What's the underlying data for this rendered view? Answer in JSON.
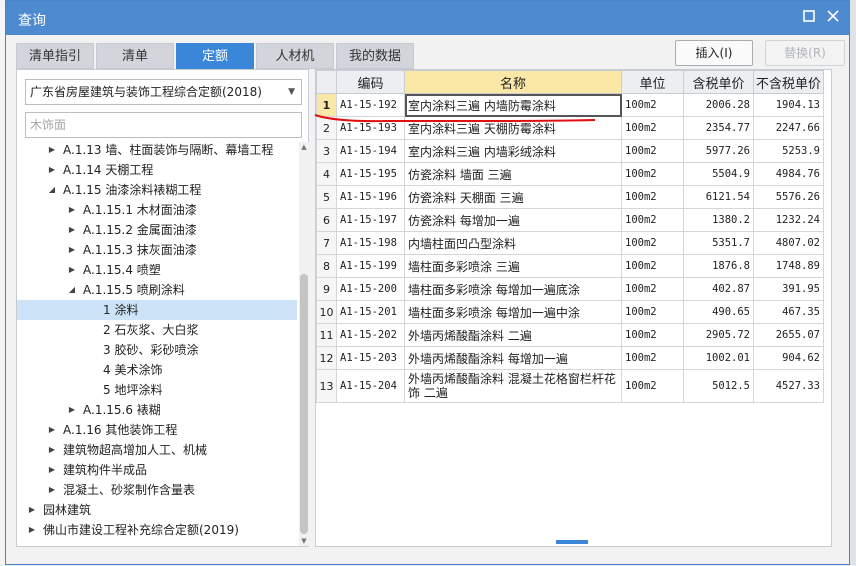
{
  "window": {
    "title": "查询"
  },
  "tabs": [
    {
      "label": "清单指引"
    },
    {
      "label": "清单"
    },
    {
      "label": "定额"
    },
    {
      "label": "人材机"
    },
    {
      "label": "我的数据"
    }
  ],
  "actions": {
    "insert": "插入(I)",
    "replace": "替换(R)"
  },
  "left": {
    "standard": "广东省房屋建筑与装饰工程综合定额(2018)",
    "search_placeholder": "木饰面",
    "tree": [
      {
        "label": "A.1.13 墙、柱面装饰与隔断、幕墙工程",
        "level": 2,
        "caret": "right"
      },
      {
        "label": "A.1.14 天棚工程",
        "level": 2,
        "caret": "right"
      },
      {
        "label": "A.1.15 油漆涂料裱糊工程",
        "level": 2,
        "caret": "down"
      },
      {
        "label": "A.1.15.1 木材面油漆",
        "level": 3,
        "caret": "right"
      },
      {
        "label": "A.1.15.2 金属面油漆",
        "level": 3,
        "caret": "right"
      },
      {
        "label": "A.1.15.3 抹灰面油漆",
        "level": 3,
        "caret": "right"
      },
      {
        "label": "A.1.15.4 喷塑",
        "level": 3,
        "caret": "right"
      },
      {
        "label": "A.1.15.5 喷刷涂料",
        "level": 3,
        "caret": "down"
      },
      {
        "label": "1 涂料",
        "level": 4,
        "caret": "",
        "selected": true
      },
      {
        "label": "2 石灰浆、大白浆",
        "level": 4,
        "caret": ""
      },
      {
        "label": "3 胶砂、彩砂喷涂",
        "level": 4,
        "caret": ""
      },
      {
        "label": "4 美术涂饰",
        "level": 4,
        "caret": ""
      },
      {
        "label": "5 地坪涂料",
        "level": 4,
        "caret": ""
      },
      {
        "label": "A.1.15.6 裱糊",
        "level": 3,
        "caret": "right"
      },
      {
        "label": "A.1.16 其他装饰工程",
        "level": 2,
        "caret": "right"
      },
      {
        "label": "建筑物超高增加人工、机械",
        "level": 2,
        "caret": "right"
      },
      {
        "label": "建筑构件半成品",
        "level": 2,
        "caret": "right"
      },
      {
        "label": "混凝土、砂浆制作含量表",
        "level": 2,
        "caret": "right"
      },
      {
        "label": "园林建筑",
        "level": 1,
        "caret": "right"
      },
      {
        "label": "佛山市建设工程补充综合定额(2019)",
        "level": 1,
        "caret": "right"
      }
    ]
  },
  "grid": {
    "columns": [
      "",
      "编码",
      "名称",
      "单位",
      "含税单价",
      "不含税单价"
    ],
    "rows": [
      {
        "no": "1",
        "code": "A1-15-192",
        "name": "室内涂料三遍 内墙防霉涂料",
        "unit": "100m2",
        "price_tax": "2006.28",
        "price_notax": "1904.13",
        "selected": true
      },
      {
        "no": "2",
        "code": "A1-15-193",
        "name": "室内涂料三遍 天棚防霉涂料",
        "unit": "100m2",
        "price_tax": "2354.77",
        "price_notax": "2247.66"
      },
      {
        "no": "3",
        "code": "A1-15-194",
        "name": "室内涂料三遍 内墙彩绒涂料",
        "unit": "100m2",
        "price_tax": "5977.26",
        "price_notax": "5253.9"
      },
      {
        "no": "4",
        "code": "A1-15-195",
        "name": "仿瓷涂料 墙面 三遍",
        "unit": "100m2",
        "price_tax": "5504.9",
        "price_notax": "4984.76"
      },
      {
        "no": "5",
        "code": "A1-15-196",
        "name": "仿瓷涂料 天棚面 三遍",
        "unit": "100m2",
        "price_tax": "6121.54",
        "price_notax": "5576.26"
      },
      {
        "no": "6",
        "code": "A1-15-197",
        "name": "仿瓷涂料 每增加一遍",
        "unit": "100m2",
        "price_tax": "1380.2",
        "price_notax": "1232.24"
      },
      {
        "no": "7",
        "code": "A1-15-198",
        "name": "内墙柱面凹凸型涂料",
        "unit": "100m2",
        "price_tax": "5351.7",
        "price_notax": "4807.02"
      },
      {
        "no": "8",
        "code": "A1-15-199",
        "name": "墙柱面多彩喷涂 三遍",
        "unit": "100m2",
        "price_tax": "1876.8",
        "price_notax": "1748.89"
      },
      {
        "no": "9",
        "code": "A1-15-200",
        "name": "墙柱面多彩喷涂 每增加一遍底涂",
        "unit": "100m2",
        "price_tax": "402.87",
        "price_notax": "391.95"
      },
      {
        "no": "10",
        "code": "A1-15-201",
        "name": "墙柱面多彩喷涂 每增加一遍中涂",
        "unit": "100m2",
        "price_tax": "490.65",
        "price_notax": "467.35"
      },
      {
        "no": "11",
        "code": "A1-15-202",
        "name": "外墙丙烯酸酯涂料 二遍",
        "unit": "100m2",
        "price_tax": "2905.72",
        "price_notax": "2655.07"
      },
      {
        "no": "12",
        "code": "A1-15-203",
        "name": "外墙丙烯酸酯涂料 每增加一遍",
        "unit": "100m2",
        "price_tax": "1002.01",
        "price_notax": "904.62"
      },
      {
        "no": "13",
        "code": "A1-15-204",
        "name": "外墙丙烯酸酯涂料 混凝土花格窗栏杆花饰 二遍",
        "unit": "100m2",
        "price_tax": "5012.5",
        "price_notax": "4527.33"
      }
    ]
  },
  "colors": {
    "accent": "#3a86d8",
    "title_bar": "#4e8ad0",
    "header_highlight": "#fbe7a6",
    "selection": "#cde3f7",
    "annotation": "#e01010"
  }
}
